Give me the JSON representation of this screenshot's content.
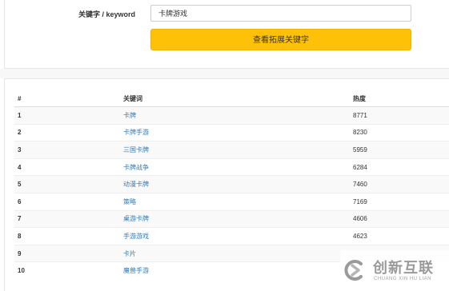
{
  "search": {
    "label": "关键字 / keyword",
    "value": "卡牌游戏",
    "button_label": "查看拓展关键字"
  },
  "table": {
    "headers": [
      "#",
      "关键词",
      "热度"
    ],
    "rows": [
      {
        "rank": "1",
        "keyword": "卡牌",
        "heat": "8771"
      },
      {
        "rank": "2",
        "keyword": "卡牌手游",
        "heat": "8230"
      },
      {
        "rank": "3",
        "keyword": "三国卡牌",
        "heat": "5959"
      },
      {
        "rank": "4",
        "keyword": "卡牌战争",
        "heat": "6284"
      },
      {
        "rank": "5",
        "keyword": "动漫卡牌",
        "heat": "7460"
      },
      {
        "rank": "6",
        "keyword": "策略",
        "heat": "7169"
      },
      {
        "rank": "7",
        "keyword": "桌游卡牌",
        "heat": "4606"
      },
      {
        "rank": "8",
        "keyword": "手游游戏",
        "heat": "4623"
      },
      {
        "rank": "9",
        "keyword": "卡片",
        "heat": ""
      },
      {
        "rank": "10",
        "keyword": "魔兽手游",
        "heat": ""
      }
    ]
  },
  "watermark": {
    "brand_cn": "创新互联",
    "brand_en": "CHUANG XIN HU LIAN"
  },
  "colors": {
    "button": "#ffc107",
    "link": "#337ab7"
  }
}
